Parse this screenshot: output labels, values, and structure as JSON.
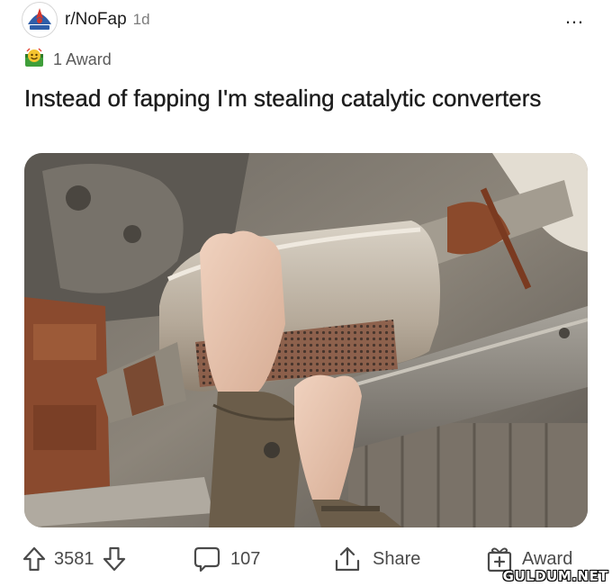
{
  "post": {
    "subreddit": "r/NoFap",
    "age": "1d",
    "awards_label": "1 Award",
    "title": "Instead of fapping I'm stealing catalytic converters",
    "more_label": "…"
  },
  "actions": {
    "upvotes": "3581",
    "comments": "107",
    "share_label": "Share",
    "award_label": "Award"
  },
  "watermark": "GULDUM.NET",
  "icons": {
    "avatar": "subreddit-avatar-icon",
    "award": "award-emoji-icon",
    "upvote": "upvote-arrow-icon",
    "downvote": "downvote-arrow-icon",
    "comment": "comment-bubble-icon",
    "share": "share-arrow-icon",
    "gift": "gift-award-icon"
  },
  "colors": {
    "text": "#1c1c1c",
    "meta": "#7c7c7c",
    "action": "#4a4a4a"
  }
}
